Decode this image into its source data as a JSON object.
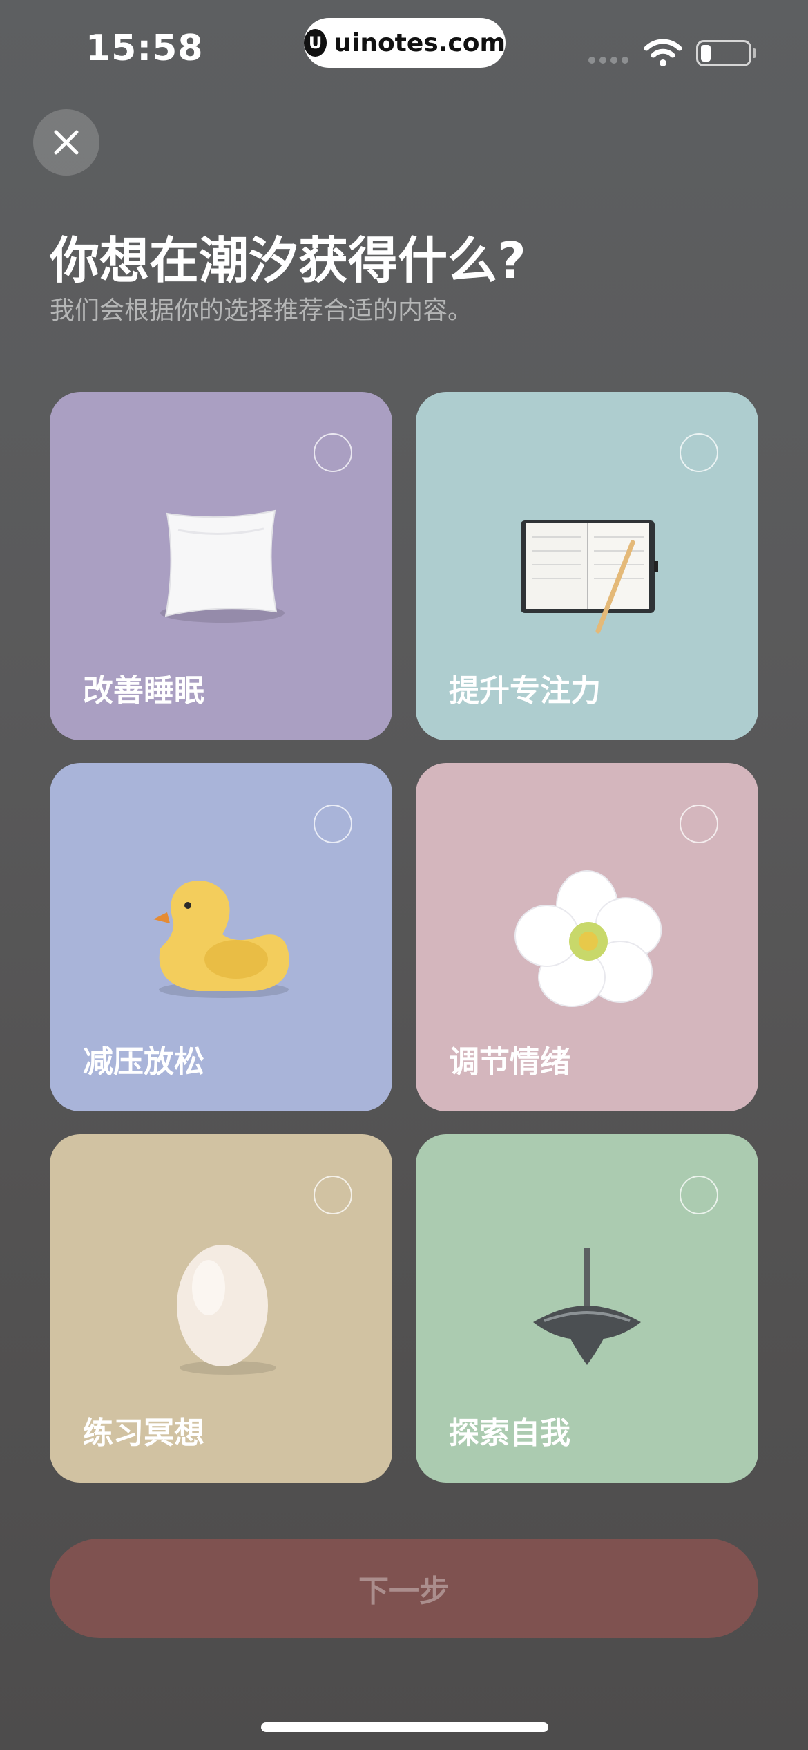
{
  "status_bar": {
    "time": "15:58",
    "site": "uinotes.com",
    "site_logo": "U"
  },
  "header": {
    "title": "你想在潮汐获得什么?",
    "subtitle": "我们会根据你的选择推荐合适的内容。"
  },
  "options": [
    {
      "label": "改善睡眠",
      "bg": "#aa9fc2",
      "icon": "pillow-icon",
      "selected": false
    },
    {
      "label": "提升专注力",
      "bg": "#aecdcf",
      "icon": "notebook-icon",
      "selected": false
    },
    {
      "label": "减压放松",
      "bg": "#a9b4d9",
      "icon": "rubber-duck-icon",
      "selected": false
    },
    {
      "label": "调节情绪",
      "bg": "#d4b6bd",
      "icon": "flower-icon",
      "selected": false
    },
    {
      "label": "练习冥想",
      "bg": "#d1c2a2",
      "icon": "egg-icon",
      "selected": false
    },
    {
      "label": "探索自我",
      "bg": "#abcbb0",
      "icon": "spinning-top-icon",
      "selected": false
    }
  ],
  "footer": {
    "next_label": "下一步"
  }
}
